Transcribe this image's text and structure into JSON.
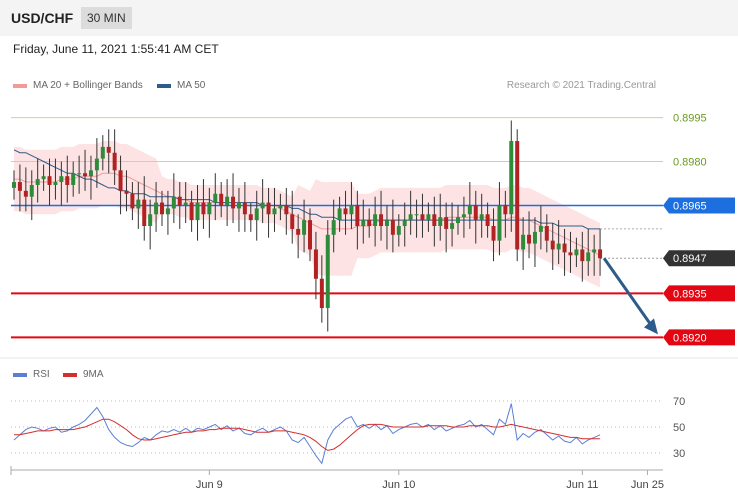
{
  "header": {
    "symbol": "USD/CHF",
    "timeframe": "30 MIN"
  },
  "timestamp": "Friday, June 11, 2021 1:55:41 AM CET",
  "credit": "Research © 2021 Trading.Central",
  "legend_main": [
    {
      "label": "MA 20 + Bollinger Bands",
      "color": "#f29a9a"
    },
    {
      "label": "MA 50",
      "color": "#2e5c8a"
    }
  ],
  "legend_rsi": [
    {
      "label": "RSI",
      "color": "#5b7fd4"
    },
    {
      "label": "9MA",
      "color": "#d32f2f"
    }
  ],
  "chart_data": [
    {
      "type": "candlestick",
      "ylim": [
        0.8915,
        0.9001
      ],
      "x_ticks": [
        {
          "label": "Jun 9",
          "i": 33
        },
        {
          "label": "Jun 10",
          "i": 65
        },
        {
          "label": "Jun 11",
          "i": 96
        },
        {
          "label": "Jun 25",
          "i": 107
        }
      ],
      "levels": [
        {
          "value": 0.8995,
          "label": "0.8995",
          "kind": "target",
          "color": "#c5d79a",
          "text": "#6a9a1f"
        },
        {
          "value": 0.898,
          "label": "0.8980",
          "kind": "target",
          "color": "#c5d79a",
          "text": "#6a9a1f"
        },
        {
          "value": 0.8965,
          "label": "0.8965",
          "kind": "pivot",
          "color": "#1d6fe0"
        },
        {
          "value": 0.8947,
          "label": "0.8947",
          "kind": "last",
          "color": "#333333"
        },
        {
          "value": 0.8935,
          "label": "0.8935",
          "kind": "support",
          "color": "#e30613"
        },
        {
          "value": 0.892,
          "label": "0.8920",
          "kind": "support",
          "color": "#e30613"
        }
      ],
      "close": [
        0.8973,
        0.897,
        0.8968,
        0.8972,
        0.8974,
        0.8975,
        0.8972,
        0.8973,
        0.8975,
        0.8972,
        0.8976,
        0.8976,
        0.8975,
        0.8977,
        0.8981,
        0.8985,
        0.8983,
        0.8977,
        0.897,
        0.8969,
        0.8964,
        0.8967,
        0.8958,
        0.8962,
        0.8966,
        0.8962,
        0.8964,
        0.8968,
        0.8965,
        0.8966,
        0.896,
        0.8966,
        0.8962,
        0.8966,
        0.8969,
        0.8965,
        0.8968,
        0.8964,
        0.8966,
        0.8962,
        0.896,
        0.8964,
        0.8966,
        0.8962,
        0.8964,
        0.8965,
        0.8962,
        0.8957,
        0.8955,
        0.896,
        0.895,
        0.894,
        0.893,
        0.8955,
        0.896,
        0.8964,
        0.8962,
        0.8965,
        0.8958,
        0.896,
        0.8958,
        0.8962,
        0.8958,
        0.896,
        0.8955,
        0.8958,
        0.896,
        0.8962,
        0.8962,
        0.896,
        0.8962,
        0.8958,
        0.8961,
        0.8957,
        0.8959,
        0.8961,
        0.8962,
        0.8965,
        0.896,
        0.8962,
        0.8958,
        0.8953,
        0.8965,
        0.8962,
        0.8987,
        0.895,
        0.8955,
        0.8952,
        0.8956,
        0.8958,
        0.8953,
        0.895,
        0.8952,
        0.8949,
        0.8948,
        0.895,
        0.8946,
        0.8949,
        0.895,
        0.8947
      ],
      "series": [
        {
          "name": "MA 50",
          "color": "#2e5c8a",
          "values": [
            0.8984,
            0.8983,
            0.8983,
            0.8982,
            0.8981,
            0.898,
            0.8979,
            0.8978,
            0.8977,
            0.8976,
            0.8976,
            0.8975,
            0.8974,
            0.8974,
            0.8973,
            0.8972,
            0.8971,
            0.8971,
            0.897,
            0.897,
            0.8969,
            0.8969,
            0.8969,
            0.8968,
            0.8968,
            0.8968,
            0.8968,
            0.8968,
            0.8967,
            0.8967,
            0.8967,
            0.8967,
            0.8967,
            0.8967,
            0.8966,
            0.8966,
            0.8966,
            0.8966,
            0.8966,
            0.8966,
            0.8966,
            0.8966,
            0.8965,
            0.8965,
            0.8965,
            0.8965,
            0.8965,
            0.8964,
            0.8964,
            0.8963,
            0.8962,
            0.8962,
            0.8961,
            0.8961,
            0.8961,
            0.896,
            0.896,
            0.896,
            0.896,
            0.896,
            0.896,
            0.896,
            0.896,
            0.896,
            0.896,
            0.896,
            0.896,
            0.896,
            0.896,
            0.896,
            0.896,
            0.896,
            0.896,
            0.896,
            0.896,
            0.896,
            0.896,
            0.896,
            0.896,
            0.896,
            0.896,
            0.896,
            0.896,
            0.896,
            0.896,
            0.896,
            0.896,
            0.896,
            0.896,
            0.8959,
            0.8959,
            0.8959,
            0.8958,
            0.8958,
            0.8958,
            0.8958,
            0.8958,
            0.8957,
            0.8957,
            0.8957
          ]
        },
        {
          "name": "MA 20",
          "color": "#f29a9a",
          "values": [
            0.8974,
            0.8974,
            0.8973,
            0.8973,
            0.8973,
            0.8973,
            0.8973,
            0.8973,
            0.8974,
            0.8974,
            0.8974,
            0.8975,
            0.8975,
            0.8975,
            0.8975,
            0.8976,
            0.8976,
            0.8976,
            0.8975,
            0.8975,
            0.8974,
            0.8973,
            0.8972,
            0.8971,
            0.897,
            0.8969,
            0.8968,
            0.8968,
            0.8967,
            0.8967,
            0.8966,
            0.8966,
            0.8966,
            0.8966,
            0.8966,
            0.8966,
            0.8966,
            0.8966,
            0.8966,
            0.8966,
            0.8966,
            0.8966,
            0.8965,
            0.8965,
            0.8965,
            0.8964,
            0.8963,
            0.8962,
            0.8961,
            0.896,
            0.8959,
            0.8958,
            0.8957,
            0.8957,
            0.8957,
            0.8957,
            0.8957,
            0.8957,
            0.8958,
            0.8958,
            0.8958,
            0.8959,
            0.896,
            0.896,
            0.896,
            0.896,
            0.896,
            0.896,
            0.896,
            0.896,
            0.896,
            0.896,
            0.896,
            0.8961,
            0.8961,
            0.8961,
            0.8961,
            0.8961,
            0.8961,
            0.8961,
            0.8961,
            0.896,
            0.896,
            0.896,
            0.8961,
            0.8961,
            0.896,
            0.896,
            0.8959,
            0.8958,
            0.8957,
            0.8956,
            0.8955,
            0.8954,
            0.8953,
            0.8952,
            0.8951,
            0.895,
            0.8949,
            0.8948
          ]
        }
      ]
    },
    {
      "type": "line",
      "title": "RSI",
      "ylim": [
        20,
        80
      ],
      "y_ticks": [
        70,
        50,
        30
      ],
      "series": [
        {
          "name": "RSI",
          "color": "#5b7fd4",
          "values": [
            40,
            44,
            48,
            50,
            49,
            47,
            49,
            50,
            46,
            47,
            50,
            52,
            55,
            60,
            65,
            58,
            48,
            42,
            38,
            36,
            35,
            38,
            42,
            40,
            44,
            47,
            46,
            48,
            46,
            49,
            46,
            49,
            48,
            50,
            52,
            48,
            51,
            47,
            49,
            45,
            44,
            47,
            49,
            46,
            48,
            50,
            47,
            40,
            38,
            42,
            35,
            28,
            22,
            40,
            48,
            52,
            56,
            58,
            50,
            52,
            49,
            52,
            48,
            51,
            45,
            48,
            50,
            52,
            53,
            50,
            52,
            48,
            51,
            47,
            49,
            51,
            52,
            55,
            50,
            52,
            48,
            44,
            56,
            52,
            68,
            40,
            45,
            42,
            46,
            48,
            44,
            40,
            43,
            39,
            38,
            42,
            37,
            40,
            42,
            44
          ]
        },
        {
          "name": "9MA",
          "color": "#d32f2f",
          "values": [
            44,
            44,
            45,
            46,
            47,
            47,
            47,
            48,
            48,
            48,
            48,
            49,
            50,
            52,
            54,
            56,
            56,
            54,
            51,
            48,
            44,
            41,
            40,
            40,
            41,
            42,
            43,
            44,
            45,
            46,
            46,
            47,
            47,
            48,
            48,
            49,
            49,
            49,
            49,
            48,
            47,
            46,
            46,
            46,
            47,
            47,
            47,
            46,
            45,
            44,
            42,
            39,
            35,
            32,
            33,
            36,
            40,
            44,
            48,
            51,
            52,
            52,
            52,
            51,
            50,
            50,
            50,
            50,
            50,
            50,
            51,
            51,
            51,
            51,
            50,
            50,
            50,
            51,
            51,
            51,
            51,
            50,
            50,
            51,
            52,
            51,
            50,
            49,
            48,
            47,
            46,
            45,
            44,
            43,
            42,
            42,
            41,
            41,
            41,
            41
          ]
        }
      ]
    }
  ]
}
